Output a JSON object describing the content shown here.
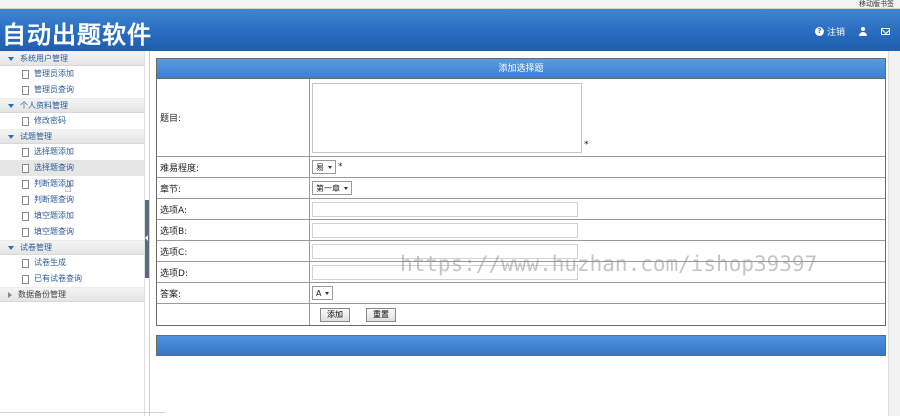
{
  "topbar": {
    "bookmark": "移动版书签"
  },
  "header": {
    "title": "自动出题软件",
    "logout_label": "注销",
    "icons": [
      "question-circle-icon",
      "user-icon",
      "mail-icon"
    ]
  },
  "sidebar": {
    "groups": [
      {
        "label": "系统用户管理",
        "expanded": true,
        "items": [
          "管理员添加",
          "管理员查询"
        ]
      },
      {
        "label": "个人资料管理",
        "expanded": true,
        "items": [
          "修改密码"
        ]
      },
      {
        "label": "试题管理",
        "expanded": true,
        "items": [
          "选择题添加",
          "选择题查询",
          "判断题添加",
          "判断题查询",
          "填空题添加",
          "填空题查询"
        ],
        "active_item": "选择题查询"
      },
      {
        "label": "试卷管理",
        "expanded": true,
        "items": [
          "试卷生成",
          "已有试卷查询"
        ]
      },
      {
        "label": "数据备份管理",
        "expanded": false,
        "items": []
      }
    ]
  },
  "form": {
    "title": "添加选择题",
    "rows": {
      "topic": {
        "label": "题目:",
        "required": "*"
      },
      "difficulty": {
        "label": "难易程度:",
        "value": "易",
        "required": "*"
      },
      "chapter": {
        "label": "章节:",
        "value": "第一章"
      },
      "option_a": {
        "label": "选项A:"
      },
      "option_b": {
        "label": "选项B:"
      },
      "option_c": {
        "label": "选项C:"
      },
      "option_d": {
        "label": "选项D:"
      },
      "answer": {
        "label": "答案:",
        "value": "A"
      }
    },
    "buttons": {
      "add": "添加",
      "reset": "重置"
    }
  },
  "watermark": "https://www.huzhan.com/ishop39397",
  "colors": {
    "header_blue": "#2a6cc0",
    "form_head_blue": "#3b7fcf",
    "link_blue": "#2a5c9a"
  }
}
